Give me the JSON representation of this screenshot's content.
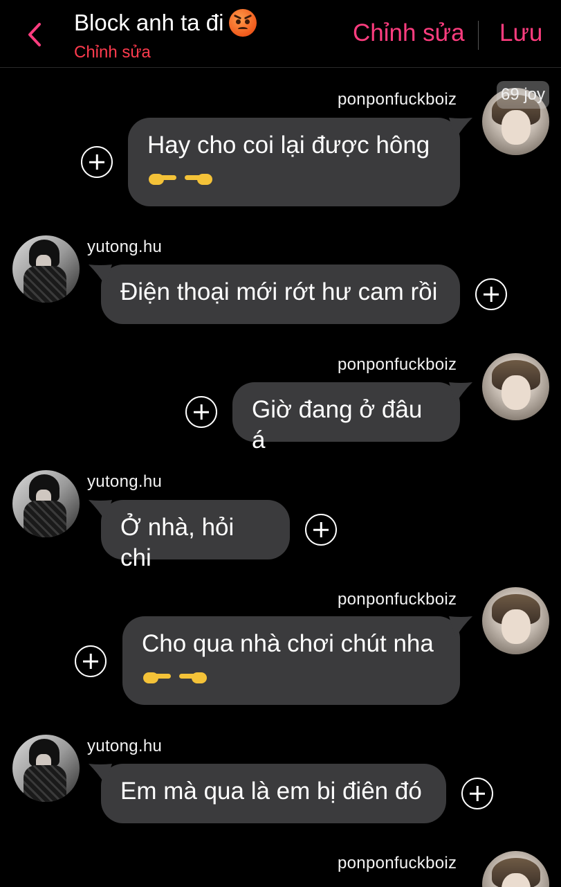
{
  "header": {
    "back_icon": "chevron-left-icon",
    "title": "Block anh ta đi",
    "title_emoji": "angry-face-emoji",
    "subtitle": "Chỉnh sửa",
    "edit_label": "Chỉnh sửa",
    "save_label": "Lưu",
    "accent_color": "#ff3d7f"
  },
  "badge": "69 joy",
  "messages": [
    {
      "sender": "ponponfuckboiz",
      "text": "Hay cho coi lại được hông",
      "emojis": "👉👈"
    },
    {
      "sender": "yutong.hu",
      "text": "Điện thoại mới rớt hư cam rồi"
    },
    {
      "sender": "ponponfuckboiz",
      "text": "Giờ đang ở đâu á"
    },
    {
      "sender": "yutong.hu",
      "text": "Ở nhà, hỏi chi"
    },
    {
      "sender": "ponponfuckboiz",
      "text": "Cho qua nhà chơi chút nha",
      "emojis": "👉👈"
    },
    {
      "sender": "yutong.hu",
      "text": "Em mà qua là em bị điên đó"
    },
    {
      "sender": "ponponfuckboiz",
      "text": ""
    }
  ]
}
